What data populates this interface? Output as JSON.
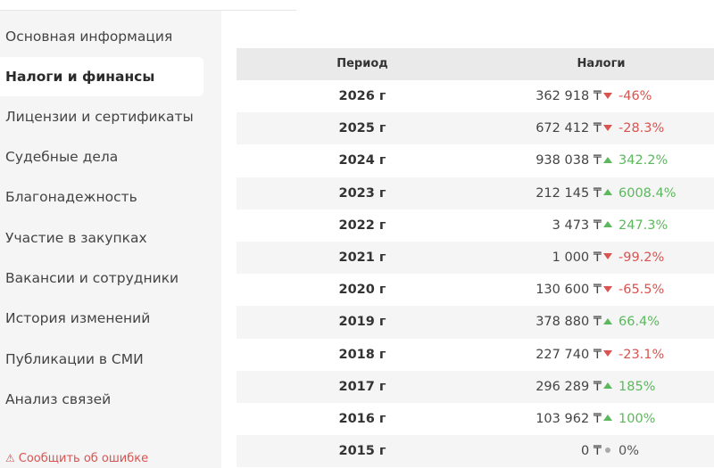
{
  "sidebar": {
    "items": [
      {
        "label": "Основная информация",
        "active": false
      },
      {
        "label": "Налоги и финансы",
        "active": true
      },
      {
        "label": "Лицензии и сертификаты",
        "active": false
      },
      {
        "label": "Судебные дела",
        "active": false
      },
      {
        "label": "Благонадежность",
        "active": false
      },
      {
        "label": "Участие в закупках",
        "active": false
      },
      {
        "label": "Вакансии и сотрудники",
        "active": false
      },
      {
        "label": "История изменений",
        "active": false
      },
      {
        "label": "Публикации в СМИ",
        "active": false
      },
      {
        "label": "Анализ связей",
        "active": false
      }
    ],
    "report_label": "Сообщить об ошибке",
    "report_icon": "warning-triangle-icon"
  },
  "table": {
    "headers": {
      "period": "Период",
      "taxes": "Налоги"
    },
    "rows": [
      {
        "year": "2026 г",
        "amount": "362 918 ₸",
        "trend": "down",
        "change": "-46%"
      },
      {
        "year": "2025 г",
        "amount": "672 412 ₸",
        "trend": "down",
        "change": "-28.3%"
      },
      {
        "year": "2024 г",
        "amount": "938 038 ₸",
        "trend": "up",
        "change": "342.2%"
      },
      {
        "year": "2023 г",
        "amount": "212 145 ₸",
        "trend": "up",
        "change": "6008.4%"
      },
      {
        "year": "2022 г",
        "amount": "3 473 ₸",
        "trend": "up",
        "change": "247.3%"
      },
      {
        "year": "2021 г",
        "amount": "1 000 ₸",
        "trend": "down",
        "change": "-99.2%"
      },
      {
        "year": "2020 г",
        "amount": "130 600 ₸",
        "trend": "down",
        "change": "-65.5%"
      },
      {
        "year": "2019 г",
        "amount": "378 880 ₸",
        "trend": "up",
        "change": "66.4%"
      },
      {
        "year": "2018 г",
        "amount": "227 740 ₸",
        "trend": "down",
        "change": "-23.1%"
      },
      {
        "year": "2017 г",
        "amount": "296 289 ₸",
        "trend": "up",
        "change": "185%"
      },
      {
        "year": "2016 г",
        "amount": "103 962 ₸",
        "trend": "up",
        "change": "100%"
      },
      {
        "year": "2015 г",
        "amount": "0 ₸",
        "trend": "flat",
        "change": "0%"
      }
    ]
  },
  "colors": {
    "down": "#d9534f",
    "up": "#5cb85c",
    "flat": "#aaaaaa"
  }
}
